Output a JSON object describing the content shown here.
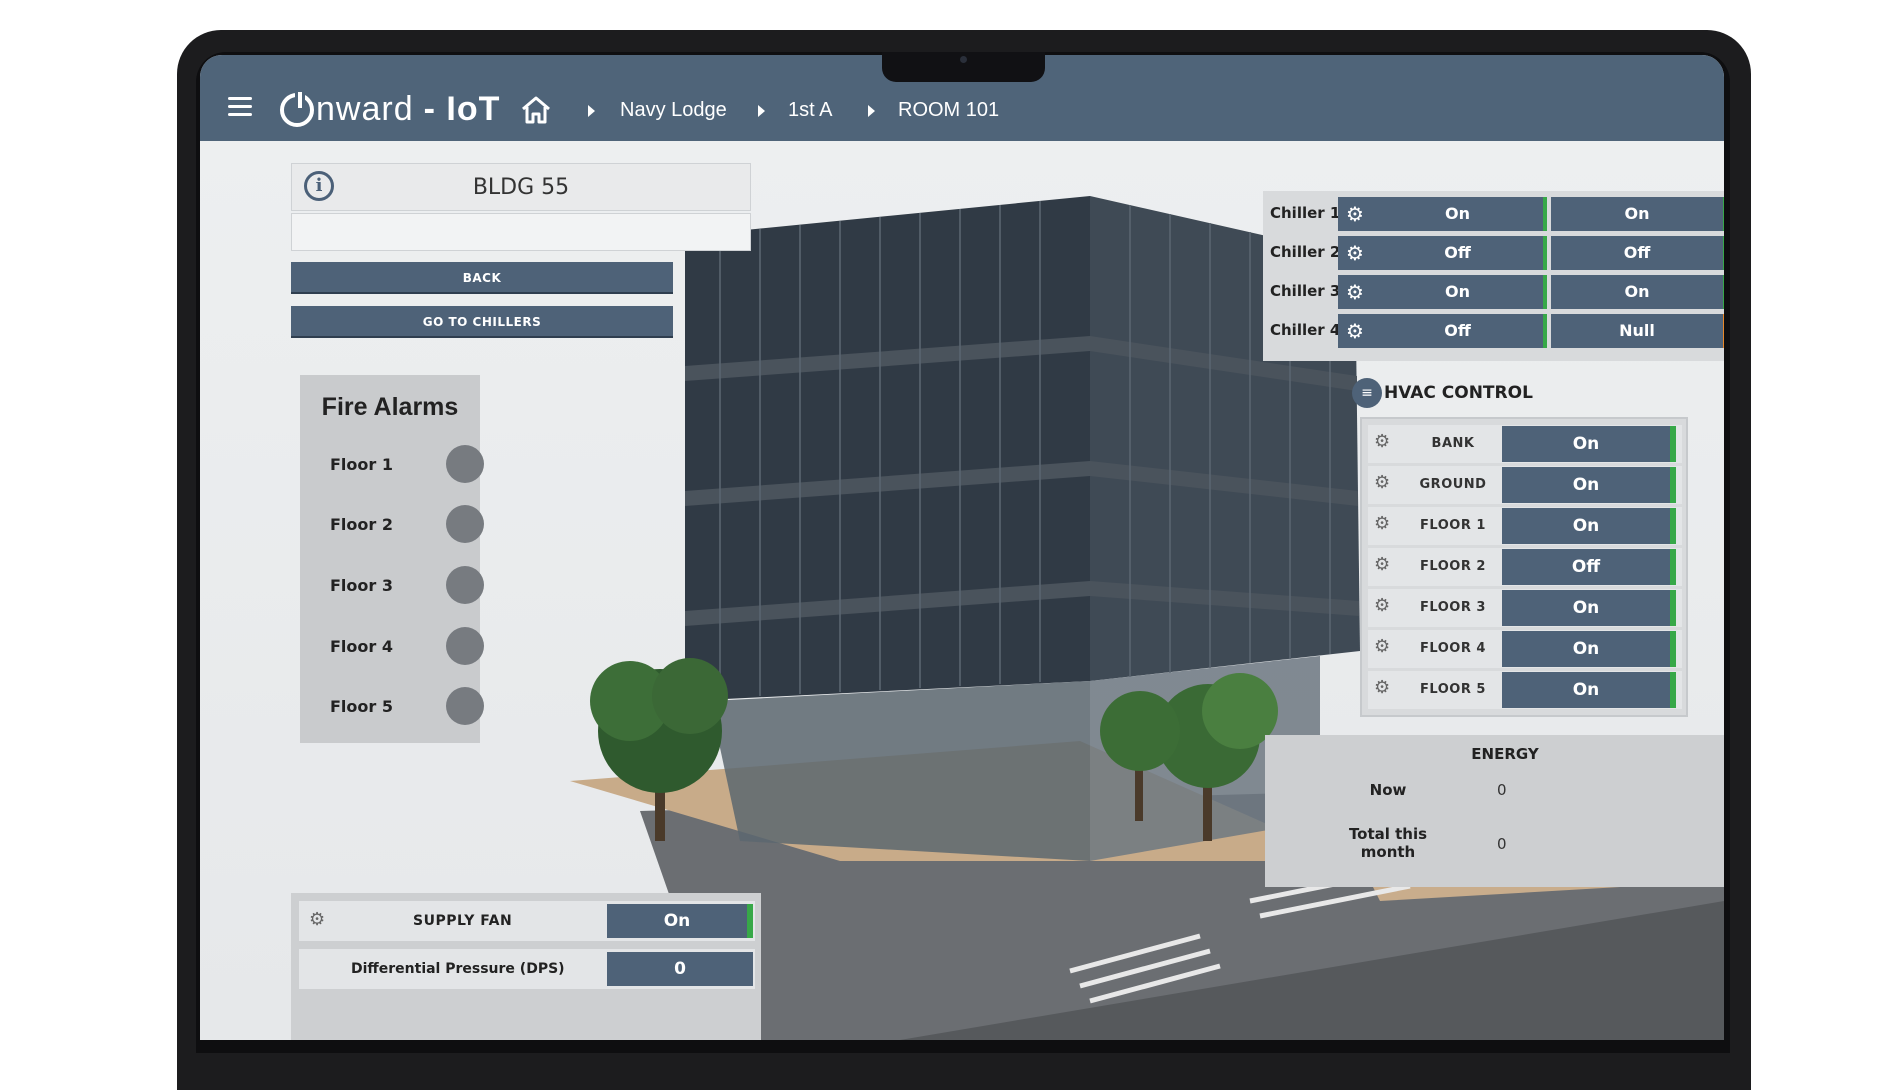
{
  "header": {
    "logo_text_light": "nward",
    "logo_text_bold": "- IoT",
    "breadcrumbs": [
      "Navy Lodge",
      "1st A",
      "ROOM 101"
    ]
  },
  "left_panel": {
    "title": "BLDG 55",
    "back_label": "BACK",
    "chillers_label": "GO TO CHILLERS"
  },
  "fire_alarms": {
    "title": "Fire Alarms",
    "floors": [
      "Floor 1",
      "Floor 2",
      "Floor 3",
      "Floor 4",
      "Floor 5"
    ]
  },
  "chillers": [
    {
      "label": "Chiller 1",
      "a": "On",
      "b": "On"
    },
    {
      "label": "Chiller 2",
      "a": "Off",
      "b": "Off"
    },
    {
      "label": "Chiller 3",
      "a": "On",
      "b": "On"
    },
    {
      "label": "Chiller 4",
      "a": "Off",
      "b": "Null"
    }
  ],
  "hvac": {
    "title": "HVAC CONTROL",
    "rows": [
      {
        "label": "BANK",
        "value": "On"
      },
      {
        "label": "GROUND",
        "value": "On"
      },
      {
        "label": "FLOOR 1",
        "value": "On"
      },
      {
        "label": "FLOOR 2",
        "value": "Off"
      },
      {
        "label": "FLOOR 3",
        "value": "On"
      },
      {
        "label": "FLOOR 4",
        "value": "On"
      },
      {
        "label": "FLOOR 5",
        "value": "On"
      }
    ]
  },
  "energy": {
    "title": "ENERGY",
    "now_label": "Now",
    "now_value": "0",
    "month_label": "Total this month",
    "month_value": "0"
  },
  "supply": {
    "fan_label": "SUPPLY FAN",
    "fan_value": "On",
    "dps_label": "Differential Pressure (DPS)",
    "dps_value": "0"
  },
  "colors": {
    "header": "#4f6479",
    "button": "#4e6278",
    "status_ok": "#37a848",
    "status_warn": "#e8882a"
  }
}
